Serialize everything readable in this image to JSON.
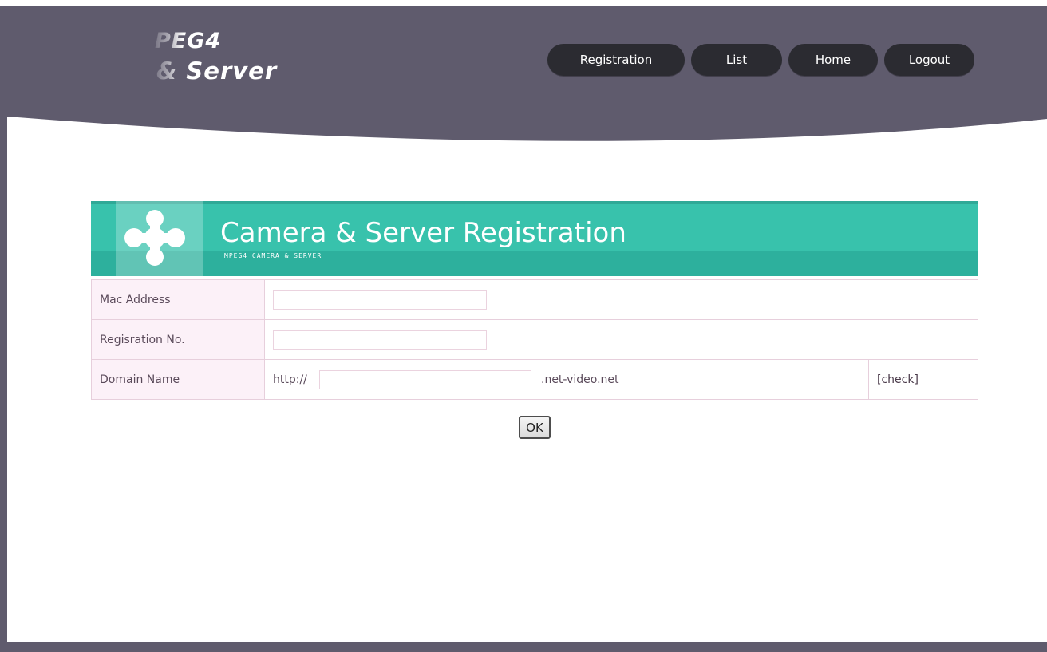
{
  "logo": {
    "line1": "PEG4",
    "line2": "& Server"
  },
  "nav": {
    "items": [
      {
        "label": "Registration"
      },
      {
        "label": "List"
      },
      {
        "label": "Home"
      },
      {
        "label": "Logout"
      }
    ]
  },
  "banner": {
    "title": "Camera & Server Registration",
    "subtitle": "MPEG4 CAMERA & SERVER",
    "icon": "clover-cross-icon"
  },
  "form": {
    "mac_address": {
      "label": "Mac Address",
      "value": ""
    },
    "registration_no": {
      "label": "Regisration No.",
      "value": ""
    },
    "domain": {
      "label": "Domain Name",
      "prefix": "http://",
      "value": "",
      "suffix": ".net-video.net",
      "check_label": "[check]"
    },
    "ok_label": "OK"
  },
  "colors": {
    "header": "#5f5b6d",
    "nav_button": "#2b2b31",
    "banner": "#38c2ac",
    "label_cell": "#fcf1f8",
    "cell_border": "#e7cfdc"
  }
}
